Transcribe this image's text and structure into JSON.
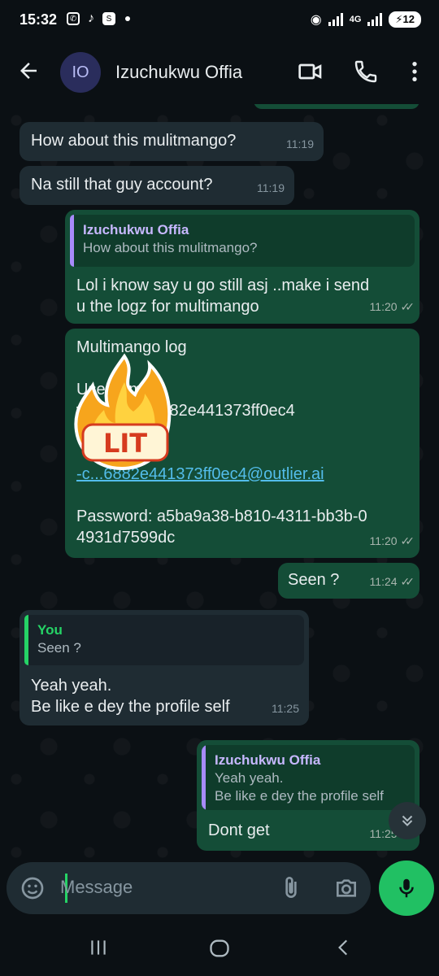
{
  "status_bar": {
    "time": "15:32",
    "network": "4G",
    "battery": "12"
  },
  "header": {
    "avatar_initials": "IO",
    "contact_name": "Izuchukwu Offia",
    "icons": [
      "back-arrow-icon",
      "video-call-icon",
      "voice-call-icon",
      "more-options-icon"
    ]
  },
  "messages": [
    {
      "direction": "in",
      "text": "How about this mulitmango?",
      "time": "11:19"
    },
    {
      "direction": "in",
      "text": "Na still that guy account?",
      "time": "11:19"
    },
    {
      "direction": "out",
      "quote_name": "Izuchukwu Offia",
      "quote_text": "How about this mulitmango?",
      "text_line1": "Lol i know say u go still asj ..make i send",
      "text_line2": "u the logz for multimango",
      "time": "11:20"
    },
    {
      "direction": "out",
      "title": "Multimango log",
      "username_label": "Username :",
      "username_value": "wfe...d6506882e441373ff0ec4",
      "email_value": "-c...6882e441373ff0ec4@outlier.ai",
      "password_line1": "Password: a5ba9a38-b810-4311-bb3b-0",
      "password_line2": "4931d7599dc",
      "sticker_text": "LIT",
      "time": "11:20"
    },
    {
      "direction": "out",
      "text": "Seen ?",
      "time": "11:24"
    },
    {
      "direction": "in",
      "quote_name": "You",
      "quote_text": "Seen ?",
      "text_line1": "Yeah yeah.",
      "text_line2": "Be like e dey the profile self",
      "time": "11:25"
    },
    {
      "direction": "out",
      "quote_name": "Izuchukwu Offia",
      "quote_line1": "Yeah yeah.",
      "quote_line2": "Be like e dey the profile self",
      "text": "Dont get",
      "time": "11:25"
    }
  ],
  "composer": {
    "placeholder": "Message"
  },
  "colors": {
    "incoming_bubble": "#1f2c33",
    "outgoing_bubble": "#144d37",
    "accent_green": "#25d366",
    "link": "#53bdeb"
  }
}
